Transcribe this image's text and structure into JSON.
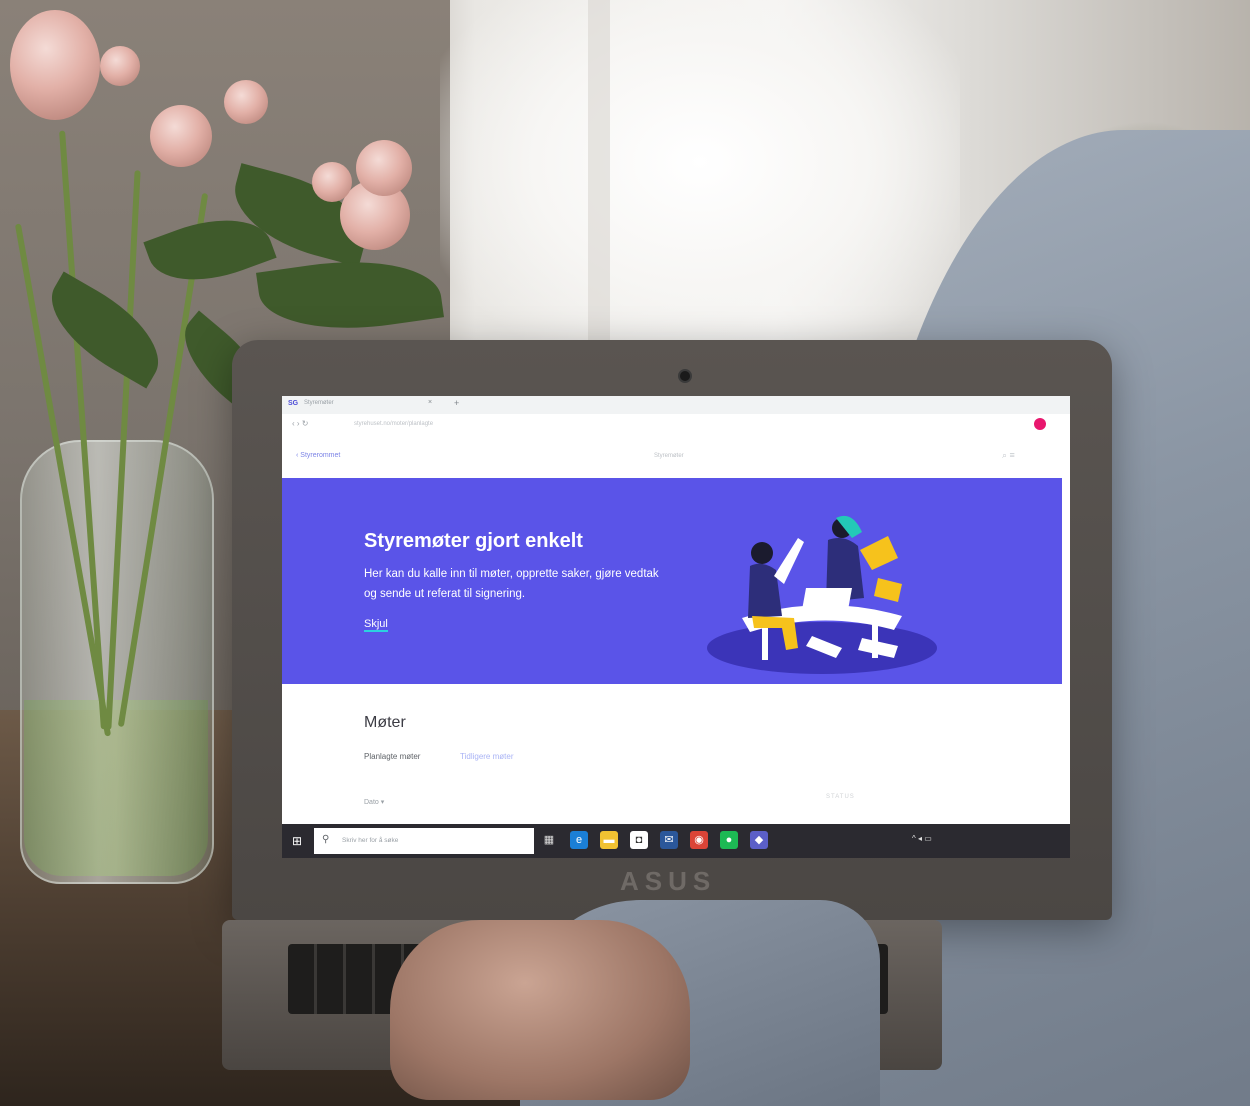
{
  "browser": {
    "tab_logo": "SG",
    "tab_title": "Styremøter",
    "tab_close": "×",
    "tab_new": "+",
    "nav": "‹  ›  ↻",
    "url": "styrehuset.no/moter/planlagte"
  },
  "app": {
    "back_link": "‹  Styrerommet",
    "title": "Styremøter",
    "icons": "⌕  ≡"
  },
  "hero": {
    "title": "Styremøter gjort enkelt",
    "description": "Her kan du kalle inn til møter, opprette saker, gjøre vedtak og sende ut referat til signering.",
    "link": "Skjul",
    "background": "#5a54e8",
    "accent": "#f6c21c"
  },
  "meetings": {
    "section_title": "Møter",
    "tabs": [
      "Planlagte møter",
      "Tidligere møter"
    ],
    "sort_label": "Dato ▾",
    "right_label": "STATUS"
  },
  "taskbar": {
    "start_icon": "windows-icon",
    "start_glyph": "⊞",
    "search_glyph": "⚲",
    "search_placeholder": "Skriv her for å søke",
    "tray": "^ ◂ ▭"
  },
  "device": {
    "brand": "ASUS"
  }
}
